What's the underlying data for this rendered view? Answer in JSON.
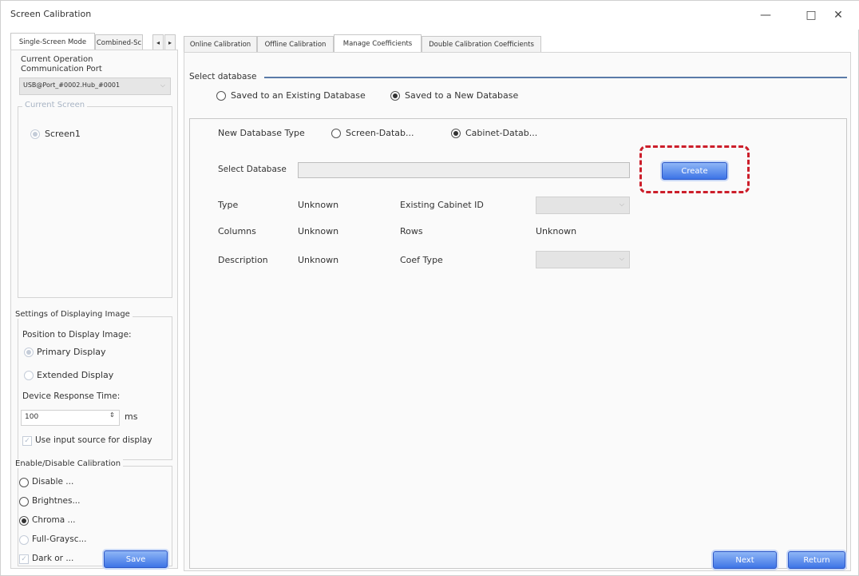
{
  "window": {
    "title": "Screen Calibration",
    "minimize_glyph": "—",
    "maximize_glyph": "□",
    "close_glyph": "✕"
  },
  "left_tabs": {
    "single": "Single-Screen Mode",
    "combined": "Combined-Sc",
    "scroll_left": "◂",
    "scroll_right": "▸"
  },
  "left_panel": {
    "op_port_label_1": "Current Operation",
    "op_port_label_2": "Communication Port",
    "port_value": "USB@Port_#0002.Hub_#0001",
    "current_screen_label": "Current Screen",
    "screen_item": "Screen1",
    "settings_title": "Settings of Displaying Image",
    "position_label": "Position to Display Image:",
    "primary_display": "Primary Display",
    "extended_display": "Extended Display",
    "response_label": "Device Response Time:",
    "response_value": "100",
    "response_unit": "ms",
    "use_input_source": "Use input source for display",
    "enable_title": "Enable/Disable Calibration",
    "opt_disable": "Disable ...",
    "opt_brightness": "Brightnes...",
    "opt_chroma": "Chroma ...",
    "opt_fullgray": "Full-Graysc...",
    "opt_dark": "Dark or ...",
    "save": "Save"
  },
  "right_tabs": [
    "Online Calibration",
    "Offline Calibration",
    "Manage Coefficients",
    "Double Calibration Coefficients"
  ],
  "main": {
    "select_db_title": "Select database",
    "existing_db": "Saved to an Existing Database",
    "new_db": "Saved to a New Database",
    "new_db_type_label": "New Database Type",
    "type_screen": "Screen-Datab...",
    "type_cabinet": "Cabinet-Datab...",
    "select_database_label": "Select Database",
    "create": "Create",
    "type_label": "Type",
    "type_value": "Unknown",
    "existing_cabinet_label": "Existing Cabinet ID",
    "columns_label": "Columns",
    "columns_value": "Unknown",
    "rows_label": "Rows",
    "rows_value": "Unknown",
    "description_label": "Description",
    "description_value": "Unknown",
    "coef_type_label": "Coef Type",
    "next": "Next",
    "return": "Return"
  },
  "colors": {
    "highlight_dashed": "#cc1e2a",
    "button_blue": "#3d74e6",
    "muted_text": "#a8b4c4"
  }
}
